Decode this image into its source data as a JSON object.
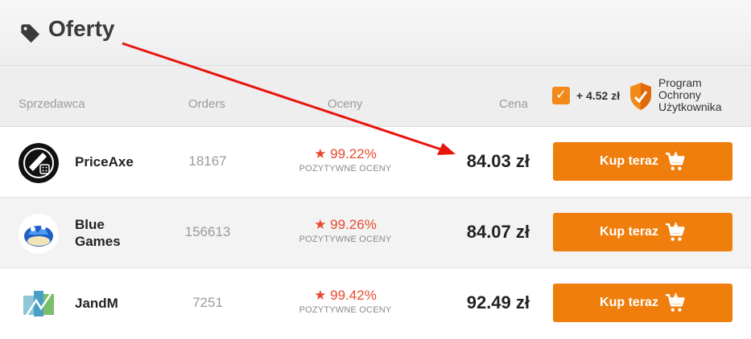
{
  "header": {
    "title": "Oferty",
    "icon": "tag-icon"
  },
  "columns": {
    "seller": "Sprzedawca",
    "orders": "Orders",
    "rating": "Oceny",
    "price": "Cena"
  },
  "protection": {
    "checked": true,
    "checkmark": "✓",
    "fee": "+ 4.52 zł",
    "label_lines": [
      "Program",
      "Ochrony",
      "Użytkownika"
    ]
  },
  "offers": [
    {
      "seller_lines": [
        "PriceAxe"
      ],
      "orders": "18167",
      "rating": "★ 99.22%",
      "rating_label": "POZYTYWNE OCENY",
      "price": "84.03 zł",
      "button": "Kup teraz"
    },
    {
      "seller_lines": [
        "Blue",
        "Games"
      ],
      "orders": "156613",
      "rating": "★ 99.26%",
      "rating_label": "POZYTYWNE OCENY",
      "price": "84.07 zł",
      "button": "Kup teraz"
    },
    {
      "seller_lines": [
        "JandM"
      ],
      "orders": "7251",
      "rating": "★ 99.42%",
      "rating_label": "POZYTYWNE OCENY",
      "price": "92.49 zł",
      "button": "Kup teraz"
    }
  ],
  "colors": {
    "accent": "#ef7e0c",
    "rating": "#e8492e",
    "annotation_arrow": "#e8140c"
  }
}
